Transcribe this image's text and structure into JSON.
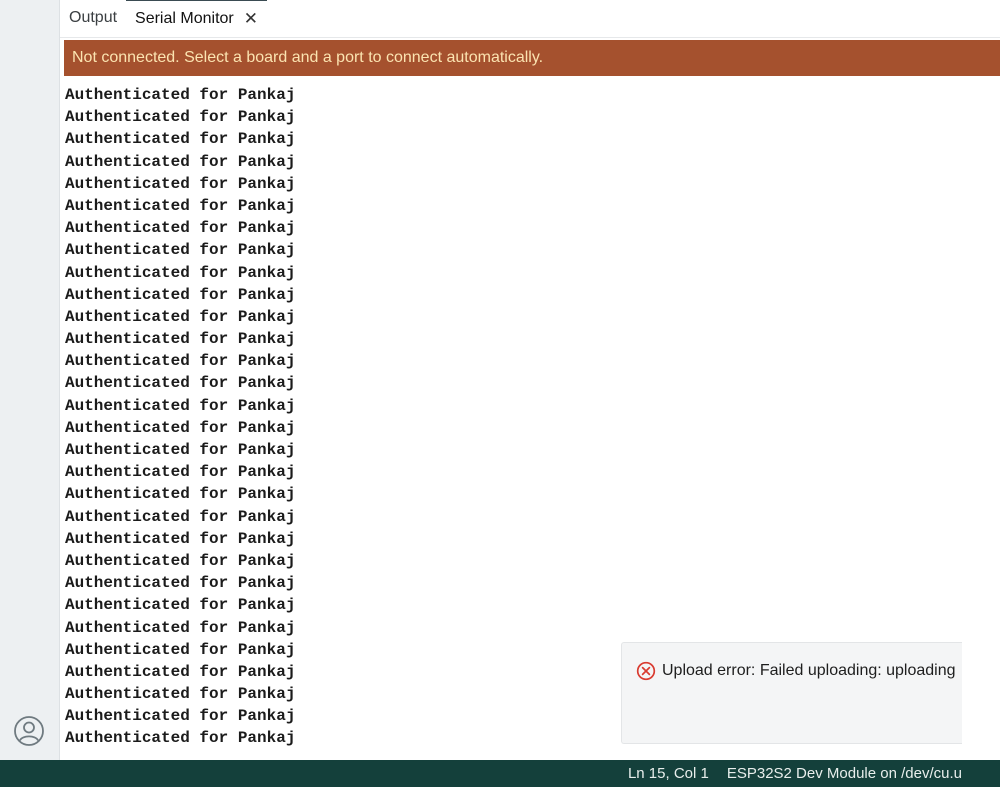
{
  "tabs": [
    {
      "label": "Output",
      "active": false
    },
    {
      "label": "Serial Monitor",
      "active": true,
      "closable": true
    }
  ],
  "banner": {
    "message": "Not connected. Select a board and a port to connect automatically.",
    "background": "#a5512e",
    "text_color": "#fbe3b0"
  },
  "console": {
    "lines": [
      "Authenticated for Pankaj",
      "Authenticated for Pankaj",
      "Authenticated for Pankaj",
      "Authenticated for Pankaj",
      "Authenticated for Pankaj",
      "Authenticated for Pankaj",
      "Authenticated for Pankaj",
      "Authenticated for Pankaj",
      "Authenticated for Pankaj",
      "Authenticated for Pankaj",
      "Authenticated for Pankaj",
      "Authenticated for Pankaj",
      "Authenticated for Pankaj",
      "Authenticated for Pankaj",
      "Authenticated for Pankaj",
      "Authenticated for Pankaj",
      "Authenticated for Pankaj",
      "Authenticated for Pankaj",
      "Authenticated for Pankaj",
      "Authenticated for Pankaj",
      "Authenticated for Pankaj",
      "Authenticated for Pankaj",
      "Authenticated for Pankaj",
      "Authenticated for Pankaj",
      "Authenticated for Pankaj",
      "Authenticated for Pankaj",
      "Authenticated for Pankaj",
      "Authenticated for Pankaj",
      "Authenticated for Pankaj",
      "Authenticated for Pankaj"
    ]
  },
  "toast": {
    "icon": "error-circle-x-icon",
    "message": "Upload error: Failed uploading: uploading",
    "icon_color": "#d93b30"
  },
  "status_bar": {
    "cursor_position": "Ln 15, Col 1",
    "board_port": "ESP32S2 Dev Module on /dev/cu.u",
    "background": "#14403b"
  },
  "left_rail": {
    "account_icon": "account-icon"
  }
}
